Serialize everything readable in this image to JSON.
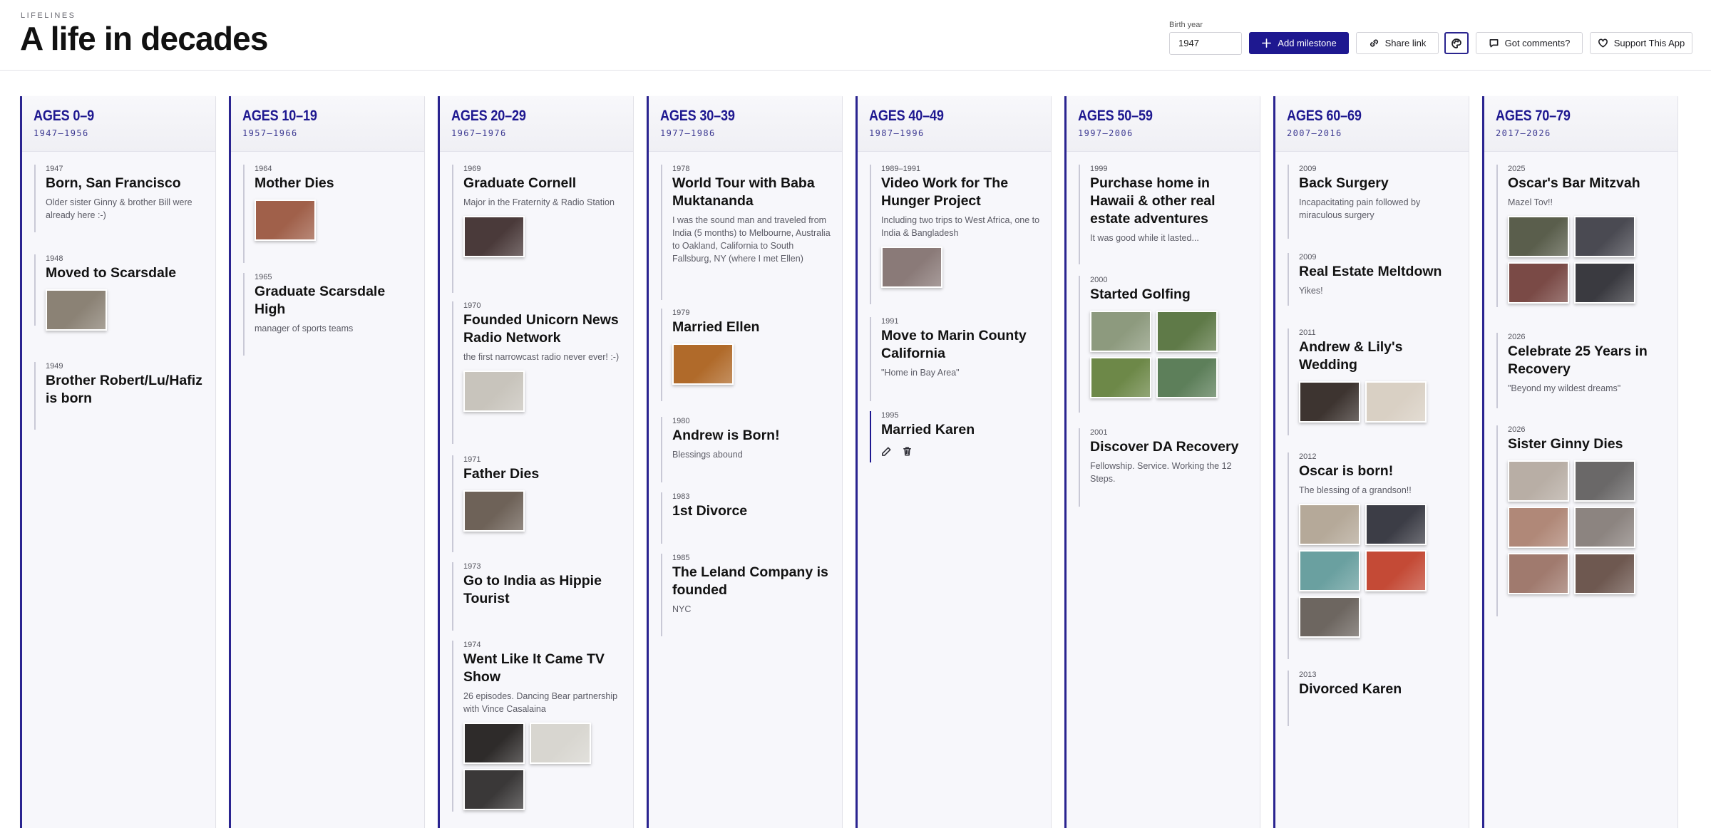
{
  "app": {
    "brand": "LIFELINES",
    "title": "A life in decades"
  },
  "toolbar": {
    "birth_year_label": "Birth year",
    "birth_year_value": "1947",
    "add_label": "Add milestone",
    "share_label": "Share link",
    "comments_label": "Got comments?",
    "support_label": "Support This App",
    "icons": [
      "plus-icon",
      "link-icon",
      "palette-icon",
      "comment-icon",
      "heart-icon"
    ]
  },
  "colors": {
    "accent": "#1e1890",
    "column_bg": "#f7f7fb",
    "border": "#d2d2d8"
  },
  "columns": [
    {
      "title": "AGES 0–9",
      "range": "1947–1956",
      "milestones": [
        {
          "year": "1947",
          "title": "Born, San Francisco",
          "note": "Older sister Ginny & brother Bill were already here :-)"
        },
        {
          "year": "1948",
          "title": "Moved to Scarsdale",
          "note": "",
          "photos": [
            "#8b8275"
          ]
        },
        {
          "year": "1949",
          "title": "Brother Robert/Lu/Hafiz is born",
          "note": ""
        }
      ]
    },
    {
      "title": "AGES 10–19",
      "range": "1957–1966",
      "milestones": [
        {
          "year": "1964",
          "title": "Mother Dies",
          "note": "",
          "photos": [
            "#a0604a"
          ]
        },
        {
          "year": "1965",
          "title": "Graduate Scarsdale High",
          "note": "manager of sports teams"
        }
      ]
    },
    {
      "title": "AGES 20–29",
      "range": "1967–1976",
      "milestones": [
        {
          "year": "1969",
          "title": "Graduate Cornell",
          "note": "Major in the Fraternity & Radio Station",
          "photos": [
            "#4a3a3a"
          ]
        },
        {
          "year": "1970",
          "title": "Founded Unicorn News Radio Network",
          "note": "the first narrowcast radio never ever! :-)",
          "photos": [
            "#c8c4bc"
          ]
        },
        {
          "year": "1971",
          "title": "Father Dies",
          "note": "",
          "photos": [
            "#6e6258"
          ]
        },
        {
          "year": "1973",
          "title": "Go to India as Hippie Tourist",
          "note": ""
        },
        {
          "year": "1974",
          "title": "Went Like It Came TV Show",
          "note": "26 episodes. Dancing Bear partnership with Vince Casalaina",
          "photos": [
            "#2e2b2a",
            "#d8d6d0",
            "#3a3838"
          ]
        }
      ]
    },
    {
      "title": "AGES 30–39",
      "range": "1977–1986",
      "milestones": [
        {
          "year": "1978",
          "title": "World Tour with Baba Muktananda",
          "note": "I was the sound man and traveled from India (5 months) to Melbourne, Australia to Oakland, California to South Fallsburg, NY (where I met Ellen)"
        },
        {
          "year": "1979",
          "title": "Married Ellen",
          "note": "",
          "photos": [
            "#b06a2a"
          ]
        },
        {
          "year": "1980",
          "title": "Andrew is Born!",
          "note": "Blessings abound"
        },
        {
          "year": "1983",
          "title": "1st Divorce",
          "note": ""
        },
        {
          "year": "1985",
          "title": "The Leland Company is founded",
          "note": "NYC"
        }
      ]
    },
    {
      "title": "AGES 40–49",
      "range": "1987–1996",
      "milestones": [
        {
          "year": "1989–1991",
          "title": "Video Work for The Hunger Project",
          "note": "Including two trips to West Africa, one to India & Bangladesh",
          "photos": [
            "#8a7a78"
          ]
        },
        {
          "year": "1991",
          "title": "Move to Marin County California",
          "note": "\"Home in Bay Area\""
        },
        {
          "year": "1995",
          "title": "Married Karen",
          "note": "",
          "actions": [
            "edit-icon",
            "trash-icon"
          ]
        }
      ]
    },
    {
      "title": "AGES 50–59",
      "range": "1997–2006",
      "milestones": [
        {
          "year": "1999",
          "title": "Purchase home in Hawaii & other real estate adventures",
          "note": "It was good while it lasted..."
        },
        {
          "year": "2000",
          "title": "Started Golfing",
          "note": "",
          "photos": [
            "#8d9a7e",
            "#5f7a48",
            "#6d8848",
            "#5d7f5a"
          ]
        },
        {
          "year": "2001",
          "title": "Discover DA Recovery",
          "note": "Fellowship. Service. Working the 12 Steps."
        }
      ]
    },
    {
      "title": "AGES 60–69",
      "range": "2007–2016",
      "milestones": [
        {
          "year": "2009",
          "title": "Back Surgery",
          "note": "Incapacitating pain followed by miraculous surgery"
        },
        {
          "year": "2009",
          "title": "Real Estate Meltdown",
          "note": "Yikes!"
        },
        {
          "year": "2011",
          "title": "Andrew & Lily's Wedding",
          "note": "",
          "photos": [
            "#3d3430",
            "#d9d0c4"
          ]
        },
        {
          "year": "2012",
          "title": "Oscar is born!",
          "note": "The blessing of a grandson!!",
          "photos": [
            "#b5a999",
            "#3c3d46",
            "#6aa0a0",
            "#c44a36",
            "#6d6660"
          ]
        },
        {
          "year": "2013",
          "title": "Divorced Karen",
          "note": ""
        }
      ]
    },
    {
      "title": "AGES 70–79",
      "range": "2017–2026",
      "milestones": [
        {
          "year": "2025",
          "title": "Oscar's Bar Mitzvah",
          "note": "Mazel Tov!!",
          "photos": [
            "#5a5e4c",
            "#4a4a52",
            "#7a4a46",
            "#3a3a40"
          ]
        },
        {
          "year": "2026",
          "title": "Celebrate 25 Years in Recovery",
          "note": "\"Beyond my wildest dreams\""
        },
        {
          "year": "2026",
          "title": "Sister Ginny Dies",
          "note": "",
          "photos": [
            "#b8aea5",
            "#6a6868",
            "#b08878",
            "#8c8480",
            "#a07a6e",
            "#6e5850"
          ]
        }
      ]
    }
  ]
}
